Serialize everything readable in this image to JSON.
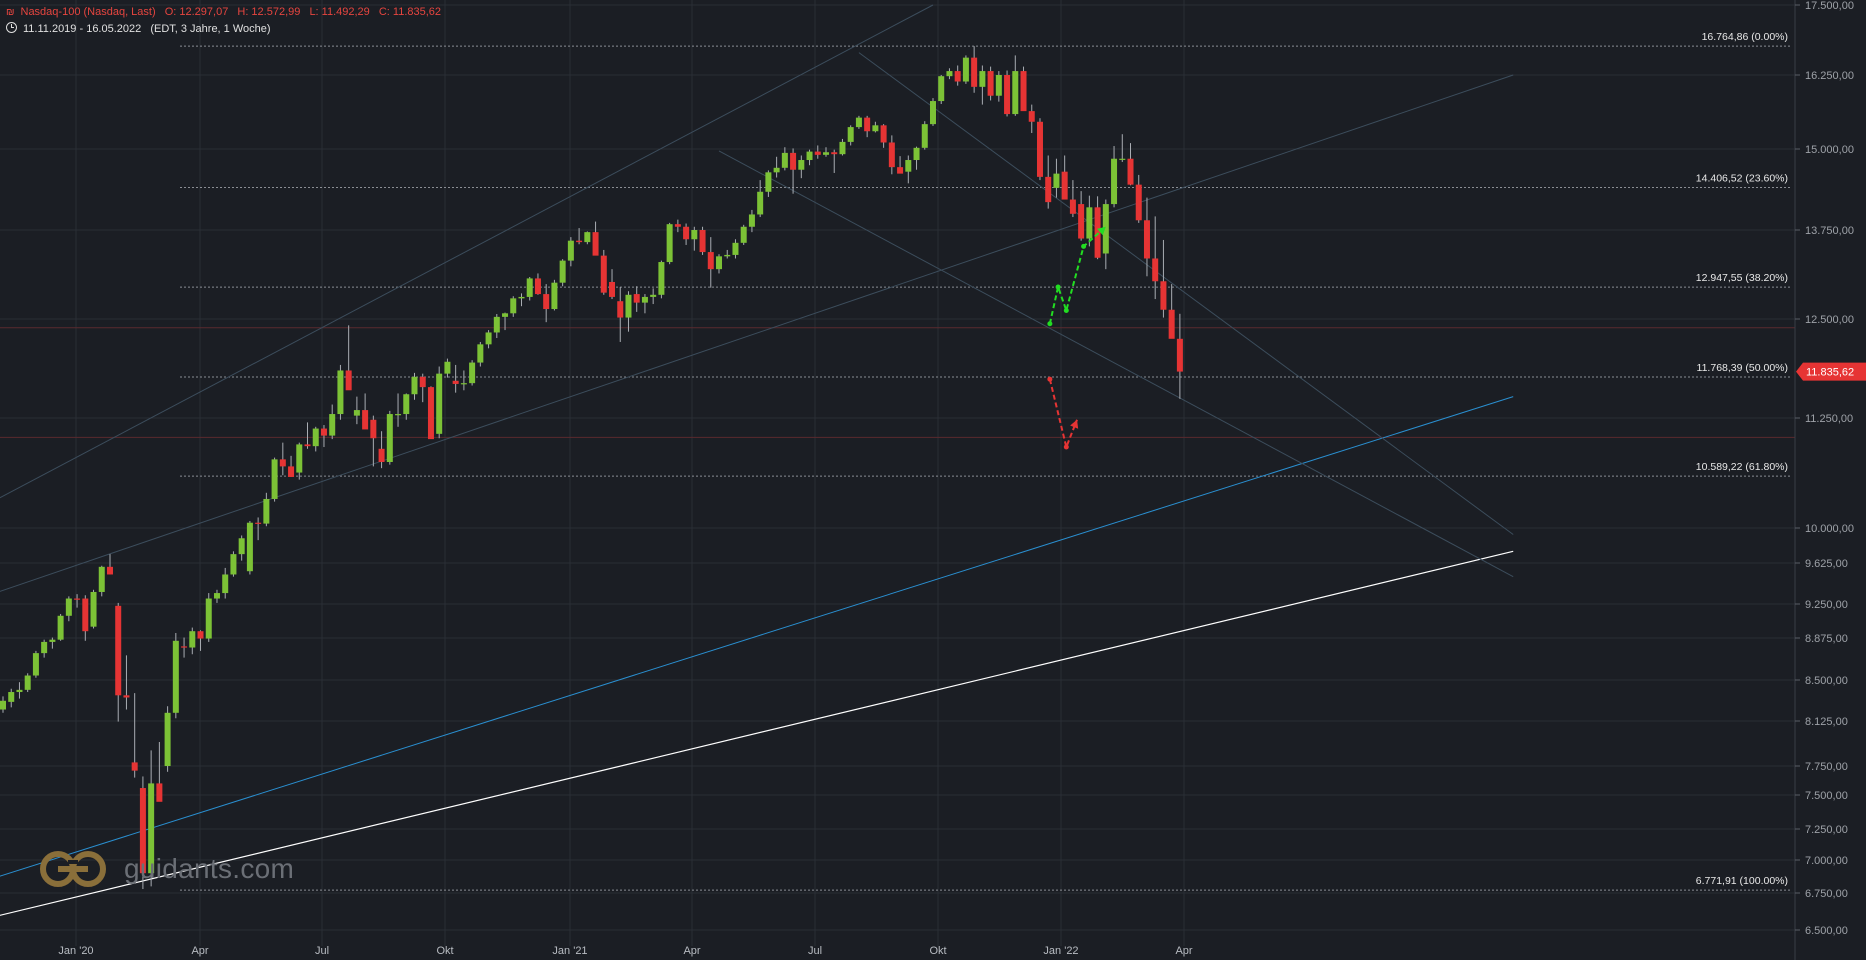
{
  "header": {
    "instrument": "Nasdaq-100 (Nasdaq, Last)",
    "open": "O: 12.297,07",
    "high": "H: 12.572,99",
    "low": "L: 11.492,29",
    "close": "C: 11.835,62",
    "range": "11.11.2019 - 16.05.2022",
    "settings": "(EDT, 3 Jahre, 1 Woche)"
  },
  "logo": {
    "text": "guidants.com"
  },
  "colors": {
    "up": "#7cc236",
    "down": "#e63434",
    "background": "#1b1e24",
    "grid": "#2a2e35",
    "target_up": "#22dd22",
    "target_down": "#e63434",
    "trend_blue": "#2a8fd0",
    "trend_white": "#ffffff"
  },
  "chart_data": {
    "type": "candlestick",
    "title": "Nasdaq-100 (Nasdaq, Last)",
    "xlabel": "",
    "ylabel": "",
    "ylim": [
      6500,
      17500
    ],
    "grid": true,
    "x_ticks": [
      "Jan '20",
      "Apr",
      "Jul",
      "Okt",
      "Jan '21",
      "Apr",
      "Jul",
      "Okt",
      "Jan '22",
      "Apr"
    ],
    "y_ticks": [
      "6.500,00",
      "6.750,00",
      "7.000,00",
      "7.250,00",
      "7.500,00",
      "7.750,00",
      "8.125,00",
      "8.500,00",
      "8.875,00",
      "9.250,00",
      "9.625,00",
      "10.000,00",
      "11.250,00",
      "12.500,00",
      "13.750,00",
      "15.000,00",
      "16.250,00",
      "17.500,00"
    ],
    "y_tick_values": [
      6500,
      6750,
      7000,
      7250,
      7500,
      7750,
      8125,
      8500,
      8875,
      9250,
      9625,
      10000,
      11250,
      12500,
      13750,
      15000,
      16250,
      17500
    ],
    "last_price": {
      "label": "11.835,62",
      "value": 11835.62
    },
    "fib_levels": [
      {
        "label": "16.764,86 (0.00%)",
        "value": 16764.86
      },
      {
        "label": "14.406,52 (23.60%)",
        "value": 14406.52
      },
      {
        "label": "12.947,55 (38.20%)",
        "value": 12947.55
      },
      {
        "label": "11.768,39 (50.00%)",
        "value": 11768.39
      },
      {
        "label": "10.589,22 (61.80%)",
        "value": 10589.22
      },
      {
        "label": "6.771,91 (100.00%)",
        "value": 6771.91
      }
    ],
    "red_horizontal_levels": [
      12390,
      11030
    ],
    "candles": [
      {
        "o": 8230,
        "h": 8350,
        "l": 8200,
        "c": 8310
      },
      {
        "o": 8300,
        "h": 8420,
        "l": 8250,
        "c": 8390
      },
      {
        "o": 8390,
        "h": 8480,
        "l": 8330,
        "c": 8410
      },
      {
        "o": 8410,
        "h": 8560,
        "l": 8390,
        "c": 8540
      },
      {
        "o": 8540,
        "h": 8760,
        "l": 8520,
        "c": 8740
      },
      {
        "o": 8740,
        "h": 8860,
        "l": 8700,
        "c": 8840
      },
      {
        "o": 8840,
        "h": 8880,
        "l": 8780,
        "c": 8860
      },
      {
        "o": 8860,
        "h": 9140,
        "l": 8850,
        "c": 9120
      },
      {
        "o": 9120,
        "h": 9320,
        "l": 9060,
        "c": 9300
      },
      {
        "o": 9300,
        "h": 9340,
        "l": 9210,
        "c": 9290
      },
      {
        "o": 9300,
        "h": 9330,
        "l": 8850,
        "c": 8950
      },
      {
        "o": 9000,
        "h": 9380,
        "l": 8980,
        "c": 9360
      },
      {
        "o": 9360,
        "h": 9600,
        "l": 9320,
        "c": 9590
      },
      {
        "o": 9590,
        "h": 9720,
        "l": 9520,
        "c": 9520
      },
      {
        "o": 9230,
        "h": 9260,
        "l": 8120,
        "c": 8360
      },
      {
        "o": 8360,
        "h": 8720,
        "l": 8230,
        "c": 8340
      },
      {
        "o": 7780,
        "h": 8380,
        "l": 7650,
        "c": 7710
      },
      {
        "o": 7560,
        "h": 7660,
        "l": 6780,
        "c": 6900
      },
      {
        "o": 6900,
        "h": 7880,
        "l": 6800,
        "c": 7600
      },
      {
        "o": 7600,
        "h": 7950,
        "l": 7480,
        "c": 7450
      },
      {
        "o": 7750,
        "h": 8260,
        "l": 7700,
        "c": 8200
      },
      {
        "o": 8200,
        "h": 8930,
        "l": 8150,
        "c": 8850
      },
      {
        "o": 8800,
        "h": 8880,
        "l": 8700,
        "c": 8790
      },
      {
        "o": 8790,
        "h": 8990,
        "l": 8730,
        "c": 8950
      },
      {
        "o": 8950,
        "h": 8960,
        "l": 8760,
        "c": 8870
      },
      {
        "o": 8870,
        "h": 9350,
        "l": 8840,
        "c": 9300
      },
      {
        "o": 9300,
        "h": 9380,
        "l": 9260,
        "c": 9350
      },
      {
        "o": 9350,
        "h": 9580,
        "l": 9300,
        "c": 9520
      },
      {
        "o": 9520,
        "h": 9750,
        "l": 9500,
        "c": 9720
      },
      {
        "o": 9720,
        "h": 9920,
        "l": 9650,
        "c": 9890
      },
      {
        "o": 9550,
        "h": 10080,
        "l": 9520,
        "c": 10060
      },
      {
        "o": 10060,
        "h": 10120,
        "l": 9870,
        "c": 10050
      },
      {
        "o": 10050,
        "h": 10400,
        "l": 10020,
        "c": 10330
      },
      {
        "o": 10330,
        "h": 10800,
        "l": 10300,
        "c": 10780
      },
      {
        "o": 10780,
        "h": 10970,
        "l": 10600,
        "c": 10700
      },
      {
        "o": 10700,
        "h": 10820,
        "l": 10580,
        "c": 10580
      },
      {
        "o": 10630,
        "h": 10970,
        "l": 10550,
        "c": 10950
      },
      {
        "o": 10950,
        "h": 11200,
        "l": 10900,
        "c": 10930
      },
      {
        "o": 10930,
        "h": 11150,
        "l": 10870,
        "c": 11130
      },
      {
        "o": 11130,
        "h": 11170,
        "l": 10920,
        "c": 11050
      },
      {
        "o": 11050,
        "h": 11420,
        "l": 11010,
        "c": 11300
      },
      {
        "o": 11300,
        "h": 11920,
        "l": 11230,
        "c": 11850
      },
      {
        "o": 11850,
        "h": 12420,
        "l": 11800,
        "c": 11600
      },
      {
        "o": 11280,
        "h": 11520,
        "l": 11180,
        "c": 11350
      },
      {
        "o": 11350,
        "h": 11560,
        "l": 11160,
        "c": 11120
      },
      {
        "o": 11230,
        "h": 11280,
        "l": 10700,
        "c": 11020
      },
      {
        "o": 10900,
        "h": 11100,
        "l": 10680,
        "c": 10750
      },
      {
        "o": 10750,
        "h": 11340,
        "l": 10720,
        "c": 11300
      },
      {
        "o": 11300,
        "h": 11560,
        "l": 11150,
        "c": 11300
      },
      {
        "o": 11300,
        "h": 11560,
        "l": 11230,
        "c": 11550
      },
      {
        "o": 11550,
        "h": 11820,
        "l": 11480,
        "c": 11770
      },
      {
        "o": 11770,
        "h": 11810,
        "l": 11450,
        "c": 11640
      },
      {
        "o": 11640,
        "h": 11650,
        "l": 11060,
        "c": 11010
      },
      {
        "o": 11070,
        "h": 11900,
        "l": 11020,
        "c": 11810
      },
      {
        "o": 11810,
        "h": 12000,
        "l": 11760,
        "c": 11960
      },
      {
        "o": 11720,
        "h": 11920,
        "l": 11570,
        "c": 11680
      },
      {
        "o": 11680,
        "h": 11850,
        "l": 11600,
        "c": 11690
      },
      {
        "o": 11690,
        "h": 11980,
        "l": 11660,
        "c": 11950
      },
      {
        "o": 11950,
        "h": 12210,
        "l": 11900,
        "c": 12180
      },
      {
        "o": 12180,
        "h": 12360,
        "l": 12130,
        "c": 12330
      },
      {
        "o": 12330,
        "h": 12570,
        "l": 12260,
        "c": 12530
      },
      {
        "o": 12530,
        "h": 12590,
        "l": 12360,
        "c": 12580
      },
      {
        "o": 12580,
        "h": 12820,
        "l": 12530,
        "c": 12790
      },
      {
        "o": 12790,
        "h": 12860,
        "l": 12680,
        "c": 12810
      },
      {
        "o": 12810,
        "h": 13090,
        "l": 12760,
        "c": 13070
      },
      {
        "o": 13070,
        "h": 13140,
        "l": 12840,
        "c": 12850
      },
      {
        "o": 12850,
        "h": 12990,
        "l": 12460,
        "c": 12640
      },
      {
        "o": 12640,
        "h": 13050,
        "l": 12620,
        "c": 13010
      },
      {
        "o": 13010,
        "h": 13340,
        "l": 12960,
        "c": 13320
      },
      {
        "o": 13320,
        "h": 13650,
        "l": 13240,
        "c": 13600
      },
      {
        "o": 13600,
        "h": 13780,
        "l": 13550,
        "c": 13580
      },
      {
        "o": 13580,
        "h": 13730,
        "l": 13550,
        "c": 13720
      },
      {
        "o": 13720,
        "h": 13880,
        "l": 13450,
        "c": 13390
      },
      {
        "o": 13390,
        "h": 13470,
        "l": 12840,
        "c": 12870
      },
      {
        "o": 13020,
        "h": 13200,
        "l": 12780,
        "c": 12810
      },
      {
        "o": 12750,
        "h": 12950,
        "l": 12210,
        "c": 12520
      },
      {
        "o": 12520,
        "h": 12890,
        "l": 12340,
        "c": 12840
      },
      {
        "o": 12850,
        "h": 12960,
        "l": 12600,
        "c": 12730
      },
      {
        "o": 12730,
        "h": 12850,
        "l": 12580,
        "c": 12810
      },
      {
        "o": 12810,
        "h": 12930,
        "l": 12710,
        "c": 12840
      },
      {
        "o": 12840,
        "h": 13320,
        "l": 12790,
        "c": 13300
      },
      {
        "o": 13300,
        "h": 13860,
        "l": 13270,
        "c": 13840
      },
      {
        "o": 13840,
        "h": 13910,
        "l": 13720,
        "c": 13800
      },
      {
        "o": 13800,
        "h": 13850,
        "l": 13540,
        "c": 13620
      },
      {
        "o": 13620,
        "h": 13800,
        "l": 13460,
        "c": 13750
      },
      {
        "o": 13750,
        "h": 13800,
        "l": 13400,
        "c": 13440
      },
      {
        "o": 13440,
        "h": 13650,
        "l": 12940,
        "c": 13200
      },
      {
        "o": 13200,
        "h": 13410,
        "l": 13140,
        "c": 13380
      },
      {
        "o": 13380,
        "h": 13470,
        "l": 13350,
        "c": 13400
      },
      {
        "o": 13400,
        "h": 13620,
        "l": 13350,
        "c": 13570
      },
      {
        "o": 13570,
        "h": 13830,
        "l": 13540,
        "c": 13800
      },
      {
        "o": 13800,
        "h": 14060,
        "l": 13720,
        "c": 13990
      },
      {
        "o": 13990,
        "h": 14520,
        "l": 13950,
        "c": 14340
      },
      {
        "o": 14340,
        "h": 14670,
        "l": 14260,
        "c": 14640
      },
      {
        "o": 14640,
        "h": 14880,
        "l": 14560,
        "c": 14710
      },
      {
        "o": 14710,
        "h": 15030,
        "l": 14670,
        "c": 14940
      },
      {
        "o": 14940,
        "h": 15010,
        "l": 14310,
        "c": 14680
      },
      {
        "o": 14680,
        "h": 14900,
        "l": 14550,
        "c": 14830
      },
      {
        "o": 14830,
        "h": 14990,
        "l": 14750,
        "c": 14960
      },
      {
        "o": 14960,
        "h": 15060,
        "l": 14850,
        "c": 14910
      },
      {
        "o": 14910,
        "h": 15030,
        "l": 14880,
        "c": 14950
      },
      {
        "o": 14950,
        "h": 14990,
        "l": 14630,
        "c": 14920
      },
      {
        "o": 14920,
        "h": 15170,
        "l": 14900,
        "c": 15120
      },
      {
        "o": 15120,
        "h": 15400,
        "l": 15060,
        "c": 15370
      },
      {
        "o": 15370,
        "h": 15560,
        "l": 15340,
        "c": 15530
      },
      {
        "o": 15530,
        "h": 15560,
        "l": 15200,
        "c": 15300
      },
      {
        "o": 15300,
        "h": 15460,
        "l": 15280,
        "c": 15400
      },
      {
        "o": 15400,
        "h": 15420,
        "l": 15020,
        "c": 15110
      },
      {
        "o": 15110,
        "h": 15230,
        "l": 14610,
        "c": 14720
      },
      {
        "o": 14720,
        "h": 14890,
        "l": 14630,
        "c": 14620
      },
      {
        "o": 14650,
        "h": 14900,
        "l": 14470,
        "c": 14830
      },
      {
        "o": 14830,
        "h": 15040,
        "l": 14680,
        "c": 15020
      },
      {
        "o": 15020,
        "h": 15470,
        "l": 14990,
        "c": 15420
      },
      {
        "o": 15420,
        "h": 15860,
        "l": 15390,
        "c": 15810
      },
      {
        "o": 15810,
        "h": 16250,
        "l": 15760,
        "c": 16230
      },
      {
        "o": 16230,
        "h": 16370,
        "l": 16180,
        "c": 16320
      },
      {
        "o": 16320,
        "h": 16420,
        "l": 16070,
        "c": 16140
      },
      {
        "o": 16140,
        "h": 16600,
        "l": 16100,
        "c": 16560
      },
      {
        "o": 16560,
        "h": 16765,
        "l": 15950,
        "c": 16050
      },
      {
        "o": 16050,
        "h": 16420,
        "l": 15750,
        "c": 16320
      },
      {
        "o": 16320,
        "h": 16400,
        "l": 15820,
        "c": 15900
      },
      {
        "o": 15900,
        "h": 16320,
        "l": 15800,
        "c": 16250
      },
      {
        "o": 16250,
        "h": 16330,
        "l": 15550,
        "c": 15590
      },
      {
        "o": 15590,
        "h": 16600,
        "l": 15560,
        "c": 16320
      },
      {
        "o": 16320,
        "h": 16400,
        "l": 15660,
        "c": 15640
      },
      {
        "o": 15640,
        "h": 15750,
        "l": 15270,
        "c": 15460
      },
      {
        "o": 15460,
        "h": 15520,
        "l": 14520,
        "c": 14570
      },
      {
        "o": 14570,
        "h": 14900,
        "l": 14080,
        "c": 14180
      },
      {
        "o": 14400,
        "h": 14850,
        "l": 14250,
        "c": 14620
      },
      {
        "o": 14650,
        "h": 14900,
        "l": 14280,
        "c": 14220
      },
      {
        "o": 14220,
        "h": 14520,
        "l": 13950,
        "c": 14000
      },
      {
        "o": 14150,
        "h": 14350,
        "l": 13600,
        "c": 13630
      },
      {
        "o": 13630,
        "h": 14280,
        "l": 13520,
        "c": 14100
      },
      {
        "o": 14100,
        "h": 14270,
        "l": 13340,
        "c": 13360
      },
      {
        "o": 13420,
        "h": 14220,
        "l": 13200,
        "c": 14150
      },
      {
        "o": 14150,
        "h": 15050,
        "l": 14100,
        "c": 14850
      },
      {
        "o": 14850,
        "h": 15250,
        "l": 14800,
        "c": 14850
      },
      {
        "o": 14850,
        "h": 15100,
        "l": 14440,
        "c": 14450
      },
      {
        "o": 14450,
        "h": 14600,
        "l": 13860,
        "c": 13900
      },
      {
        "o": 13900,
        "h": 14250,
        "l": 13100,
        "c": 13350
      },
      {
        "o": 13350,
        "h": 13960,
        "l": 12780,
        "c": 13030
      },
      {
        "o": 13030,
        "h": 13610,
        "l": 12520,
        "c": 12630
      },
      {
        "o": 12630,
        "h": 12990,
        "l": 12300,
        "c": 12250
      },
      {
        "o": 12250,
        "h": 12573,
        "l": 11492,
        "c": 11836
      }
    ],
    "trendlines": [
      {
        "color": "white",
        "from": {
          "i": -3.3,
          "v": 6560
        },
        "to": {
          "i": 183.5,
          "v": 9750
        }
      },
      {
        "color": "blue",
        "from": {
          "i": -3.3,
          "v": 6820
        },
        "to": {
          "i": 183.5,
          "v": 11520
        }
      },
      {
        "color": "faint",
        "from": {
          "i": -3.3,
          "v": 9290
        },
        "to": {
          "i": 183.5,
          "v": 16250
        }
      },
      {
        "color": "faint",
        "from": {
          "i": -3.3,
          "v": 10200
        },
        "to": {
          "i": 113,
          "v": 17500
        }
      },
      {
        "color": "faint",
        "from": {
          "i": 104,
          "v": 16650
        },
        "to": {
          "i": 183.5,
          "v": 9930
        }
      },
      {
        "color": "faint",
        "from": {
          "i": 87,
          "v": 14970
        },
        "to": {
          "i": 183.5,
          "v": 9500
        }
      }
    ],
    "projection_paths": [
      {
        "direction": "up",
        "points": [
          {
            "i": 127.2,
            "v": 12440
          },
          {
            "i": 128.2,
            "v": 12950
          },
          {
            "i": 129.2,
            "v": 12620
          },
          {
            "i": 131.3,
            "v": 13520
          },
          {
            "i": 134,
            "v": 13800
          }
        ]
      },
      {
        "direction": "down",
        "points": [
          {
            "i": 127.2,
            "v": 11740
          },
          {
            "i": 129.2,
            "v": 10920
          },
          {
            "i": 130.5,
            "v": 11230
          }
        ]
      }
    ]
  }
}
